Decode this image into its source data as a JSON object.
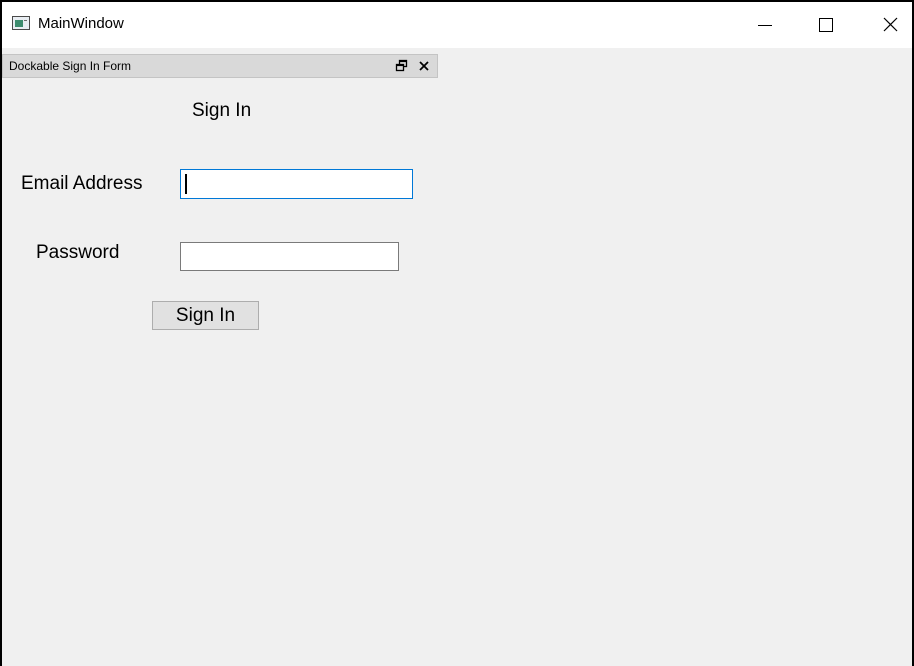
{
  "window": {
    "title": "MainWindow"
  },
  "titlebar_buttons": {
    "minimize_icon": "minimize-icon",
    "maximize_icon": "maximize-icon",
    "close_icon": "close-icon"
  },
  "dock": {
    "title": "Dockable Sign In Form",
    "float_icon": "float-icon",
    "close_icon": "close-icon"
  },
  "form": {
    "heading": "Sign In",
    "email_label": "Email Address",
    "email_value": "",
    "password_label": "Password",
    "password_value": "",
    "submit_label": "Sign In"
  },
  "colors": {
    "focus_border": "#0078d7",
    "window_background": "#f0f0f0",
    "dock_header_background": "#d9d9d9"
  }
}
